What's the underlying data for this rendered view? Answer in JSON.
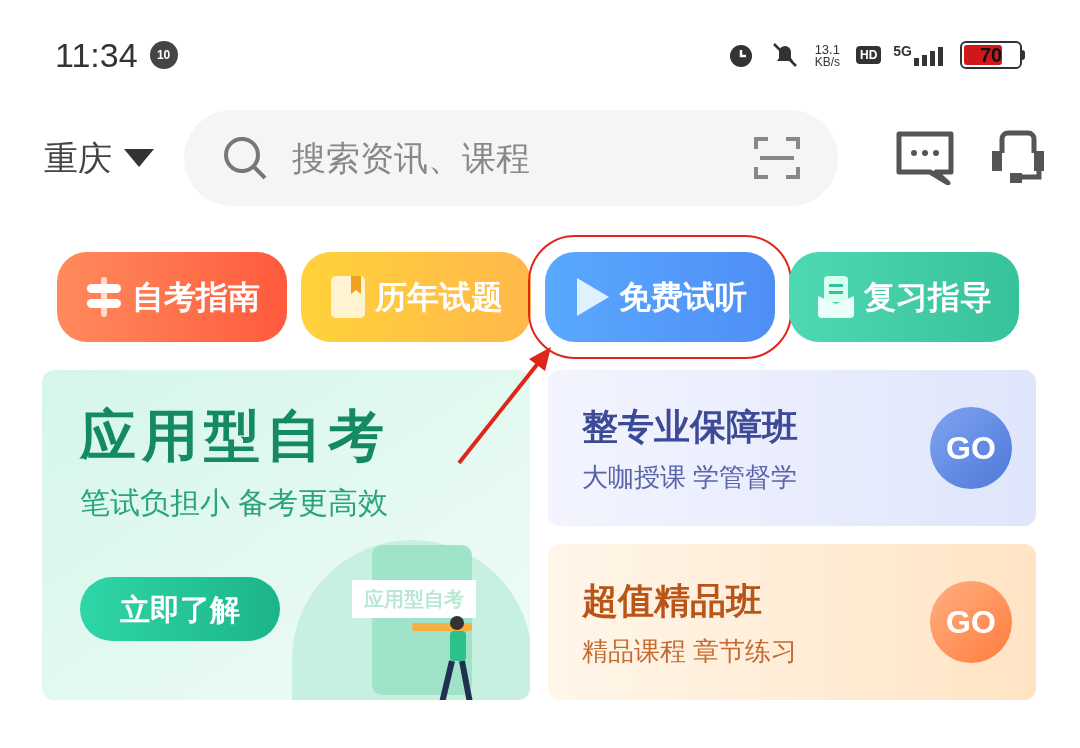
{
  "status_bar": {
    "time": "11:34",
    "notification_badge": "10",
    "speed_value": "13.1",
    "speed_unit": "KB/s",
    "hd_label": "HD",
    "network": "5G",
    "battery_text": "70",
    "battery": {
      "level": 0.7
    }
  },
  "header": {
    "city": "重庆",
    "search": {
      "placeholder": "搜索资讯、课程"
    }
  },
  "shortcuts": [
    {
      "label": "自考指南",
      "kind": "guide",
      "highlighted": false
    },
    {
      "label": "历年试题",
      "kind": "papers",
      "highlighted": false
    },
    {
      "label": "免费试听",
      "kind": "play",
      "highlighted": true
    },
    {
      "label": "复习指导",
      "kind": "review",
      "highlighted": false
    }
  ],
  "feature_card": {
    "title": "应用型自考",
    "subtitle": "笔试负担小 备考更高效",
    "button": "立即了解",
    "illustration_text": "应用型自考"
  },
  "course_cards": [
    {
      "title": "整专业保障班",
      "subtitle": "大咖授课 学管督学",
      "go": "GO",
      "kind": "blue"
    },
    {
      "title": "超值精品班",
      "subtitle": "精品课程 章节练习",
      "go": "GO",
      "kind": "orange"
    }
  ]
}
